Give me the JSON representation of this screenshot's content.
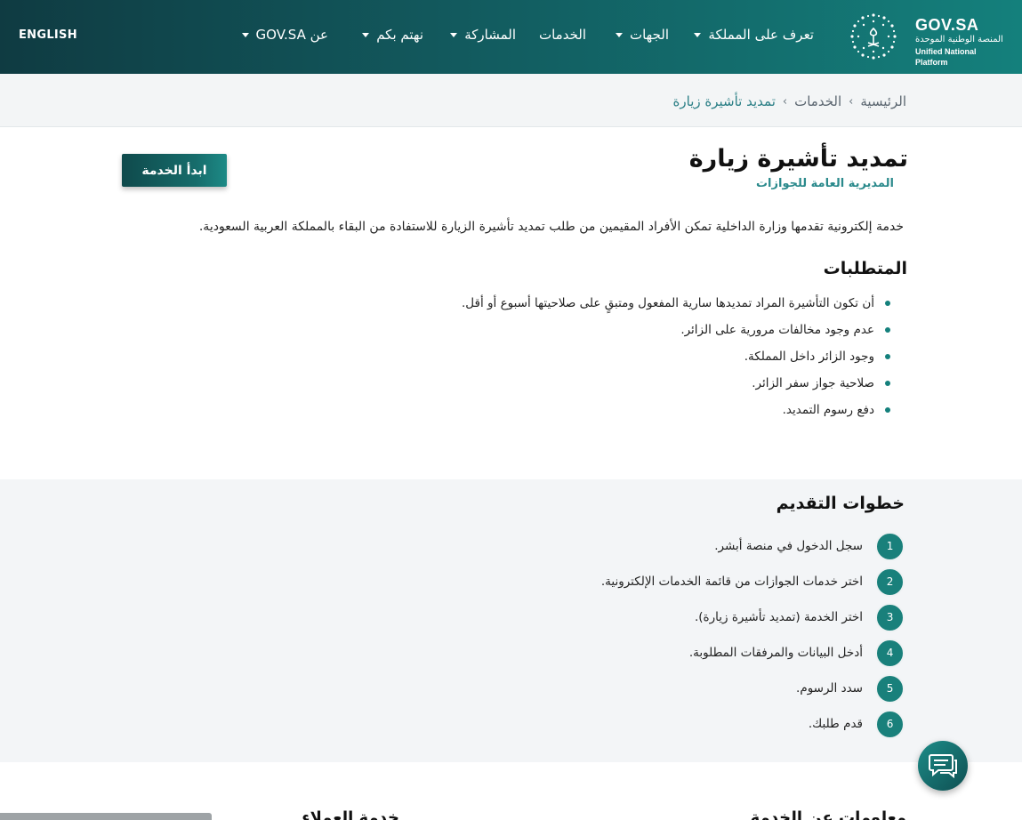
{
  "header": {
    "lang_label": "ENGLISH",
    "logo": {
      "title": "GOV.SA",
      "ar": "المنصة الوطنية الموحدة",
      "en": "Unified National Platform"
    },
    "nav": [
      {
        "label": "تعرف على المملكة",
        "dropdown": true
      },
      {
        "label": "الجهات",
        "dropdown": true
      },
      {
        "label": "الخدمات",
        "dropdown": false
      },
      {
        "label": "المشاركة",
        "dropdown": true
      },
      {
        "label": "نهتم بكم",
        "dropdown": true
      },
      {
        "label": "عن GOV.SA",
        "dropdown": true
      }
    ]
  },
  "breadcrumb": {
    "home": "الرئيسية",
    "services": "الخدمات",
    "current": "تمديد تأشيرة زيارة"
  },
  "service": {
    "title": "تمديد تأشيرة زيارة",
    "agency": "المديرية العامة للجوازات",
    "start_label": "ابدأ الخدمة",
    "description": "خدمة إلكترونية تقدمها وزارة الداخلية تمكن الأفراد المقيمين من طلب تمديد تأشيرة الزيارة للاستفادة من البقاء بالمملكة العربية السعودية."
  },
  "requirements": {
    "title": "المتطلبات",
    "items": [
      "أن تكون التأشيرة المراد تمديدها سارية المفعول ومتبقٍ على صلاحيتها أسبوع أو أقل.",
      "عدم وجود مخالفات مرورية على الزائر.",
      "وجود الزائر داخل المملكة.",
      "صلاحية جواز سفر الزائر.",
      "دفع رسوم التمديد."
    ]
  },
  "steps": {
    "title": "خطوات التقديم",
    "items": [
      {
        "num": "1",
        "text": "سجل الدخول في منصة أبشر."
      },
      {
        "num": "2",
        "text": "اختر خدمات الجوازات من قائمة الخدمات الإلكترونية."
      },
      {
        "num": "3",
        "text": "اختر الخدمة (تمديد تأشيرة زيارة)."
      },
      {
        "num": "4",
        "text": "أدخل البيانات والمرفقات المطلوبة."
      },
      {
        "num": "5",
        "text": "سدد الرسوم."
      },
      {
        "num": "6",
        "text": "قدم طلبك."
      }
    ]
  },
  "footer": {
    "about_service": "معلومات عن الخدمة",
    "customer_service": "خدمة العملاء"
  },
  "chat": {
    "icon": "chat-icon"
  },
  "colors": {
    "primary": "#14807c",
    "header_dark": "#0f3b42",
    "agency": "#2b8a8c"
  }
}
